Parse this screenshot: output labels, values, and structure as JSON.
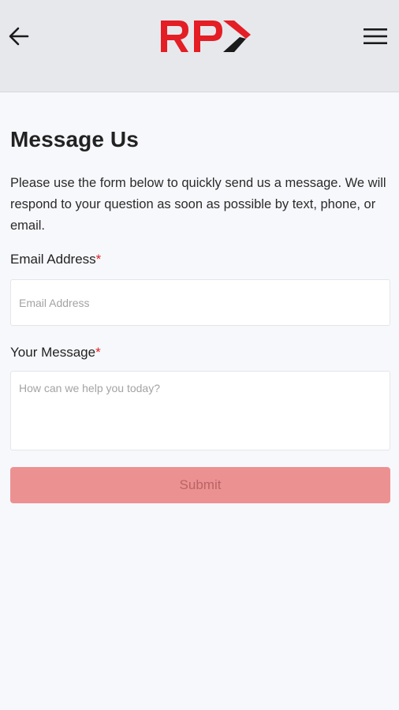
{
  "header": {
    "logo_text": "RP",
    "back_icon": "arrow-left-icon",
    "menu_icon": "hamburger-menu-icon"
  },
  "page": {
    "title": "Message Us",
    "intro": "Please use the form below to quickly send us a message. We will respond to your question as soon as possible by text, phone, or email."
  },
  "form": {
    "email": {
      "label": "Email Address",
      "required_mark": "*",
      "placeholder": "Email Address",
      "value": ""
    },
    "message": {
      "label": "Your Message",
      "required_mark": "*",
      "placeholder": "How can we help you today?",
      "value": ""
    },
    "submit_label": "Submit"
  },
  "colors": {
    "brand_red": "#e31e24",
    "logo_dark": "#1a1a1a",
    "header_bg": "#e6e8ec",
    "submit_disabled_bg": "#ec9192"
  }
}
